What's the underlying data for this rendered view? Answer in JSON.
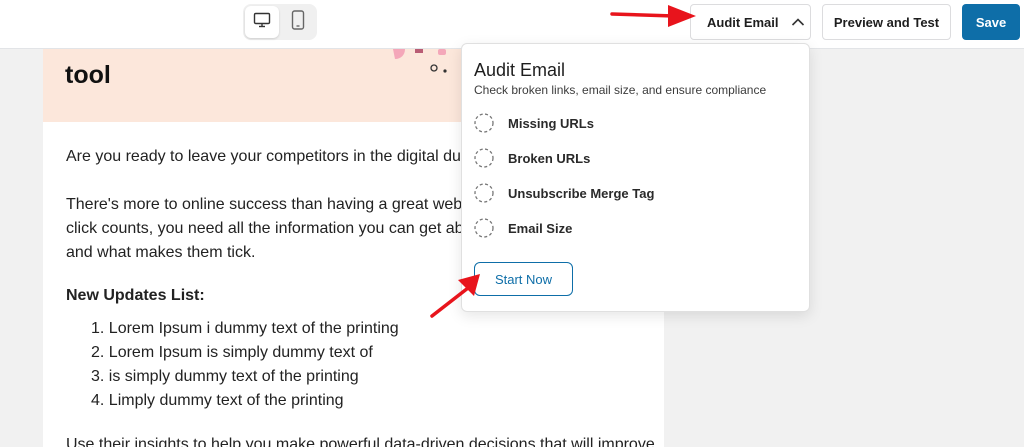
{
  "toolbar": {
    "device_desktop_icon": "desktop-icon",
    "device_mobile_icon": "mobile-icon",
    "audit_label": "Audit Email",
    "preview_label": "Preview and Test",
    "save_label": "Save"
  },
  "email": {
    "hero_title": "tool",
    "paragraph1": "Are you ready to leave your competitors in the digital dust",
    "paragraph2_lines": [
      "There's more to online success than having a great websi",
      "click counts, you need all the information you can get abo",
      "and what makes them tick."
    ],
    "list_heading": "New Updates List:",
    "list_items": [
      "1. Lorem Ipsum i dummy text of the printing",
      "2. Lorem Ipsum is simply dummy text of",
      "3. is simply dummy text of the printing",
      "4. Limply dummy text of the printing"
    ],
    "paragraph3": "Use their insights to help you make powerful data-driven decisions that will improve"
  },
  "audit_panel": {
    "title": "Audit Email",
    "subtitle": "Check broken links, email size, and ensure compliance",
    "checks": [
      "Missing URLs",
      "Broken URLs",
      "Unsubscribe Merge Tag",
      "Email Size"
    ],
    "start_label": "Start Now"
  },
  "colors": {
    "primary": "#0e6ea8",
    "hero_bg": "#fce7db",
    "arrow": "#e8141c"
  }
}
